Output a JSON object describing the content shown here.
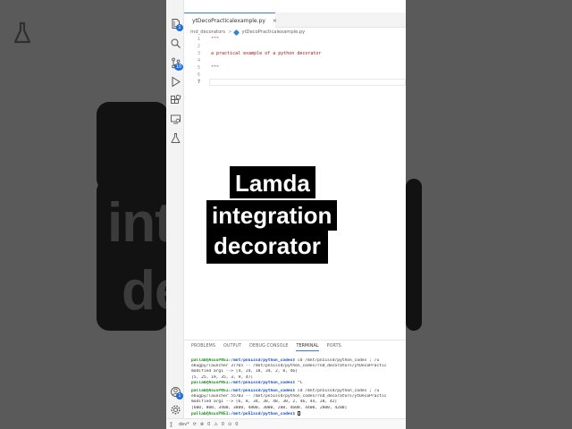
{
  "editor_tab": {
    "filename": "ytDecoPracticalexample.py",
    "close": "×"
  },
  "breadcrumb": {
    "folder": "rnd_decorators",
    "separator": ">",
    "file": "ytDecoPracticalexample.py"
  },
  "line_numbers": [
    "1",
    "2",
    "3",
    "4",
    "5",
    "6",
    "7"
  ],
  "code_lines": [
    "\"\"\"",
    "",
    "a practical example of a python decorator",
    "",
    "\"\"\"",
    "",
    ""
  ],
  "badges": {
    "explorer": "1",
    "scm": "10",
    "accounts": "1"
  },
  "panel_tabs": [
    "PROBLEMS",
    "OUTPUT",
    "DEBUG CONSOLE",
    "TERMINAL",
    "PORTS"
  ],
  "terminal": {
    "prompt_user": "pallab@AsusPN51",
    "prompt_path": ":/mnt/pn51ssd/python_codes",
    "prompt_end": "$",
    "run1_cmd": " cd /mnt/pn51ssd/python_codes ; /u",
    "run1_out": [
      "ebugpy/launcher 37765 -- /mnt/pn51ssd/python_codes/rnd_decorators/ytDecoPractic",
      "modified arg1 --> [4, 24, 18, 34, 2, 8, 46]",
      "[5, 25, 19, 35, 3, 9, 47]"
    ],
    "run1_end": " ^C",
    "run2_cmd": " cd /mnt/pn51ssd/python_codes ; /u",
    "run2_out": [
      "ebugpy/launcher 55703 -- /mnt/pn51ssd/python_codes/rnd_decorators/ytDecoPractic",
      "modified arg1 --> [6, 8, 34, 38, 48, 30, 2, 46, 44, 28, 42]",
      "[600, 800, 3400, 3800, 4800, 3000, 200, 4600, 4400, 2800, 4200]"
    ]
  },
  "status": {
    "branch": "dev*",
    "errors": "0",
    "warnings": "0",
    "info": "0"
  },
  "caption": {
    "line1": "Lamda",
    "line2": "integration",
    "line3": "decorator"
  },
  "background": {
    "blur_left": "int",
    "blur_left_2": "de"
  },
  "colors": {
    "accent": "#3a7bd5",
    "string": "#a31515",
    "terminal_user": "#1a8a1a",
    "terminal_path": "#1a4fc4"
  }
}
